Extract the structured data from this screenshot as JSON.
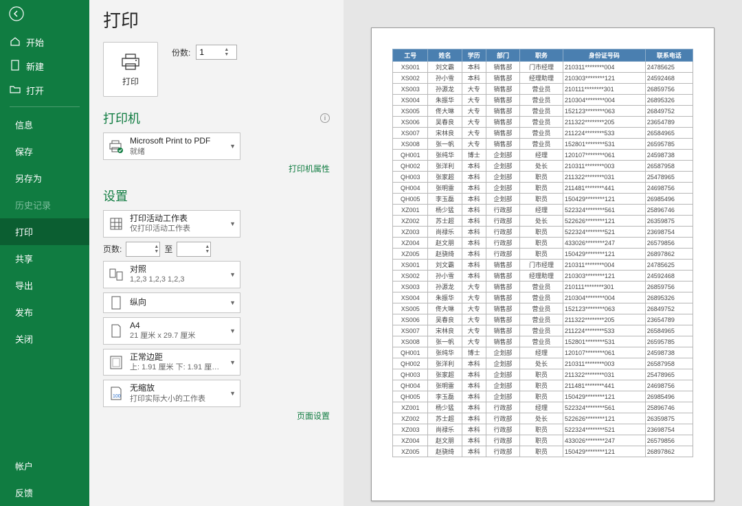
{
  "sidebar": {
    "items": [
      {
        "icon": "home",
        "label": "开始"
      },
      {
        "icon": "new",
        "label": "新建"
      },
      {
        "icon": "open",
        "label": "打开"
      }
    ],
    "items2": [
      {
        "label": "信息"
      },
      {
        "label": "保存"
      },
      {
        "label": "另存为"
      },
      {
        "label": "历史记录",
        "disabled": true
      },
      {
        "label": "打印",
        "selected": true
      },
      {
        "label": "共享"
      },
      {
        "label": "导出"
      },
      {
        "label": "发布"
      },
      {
        "label": "关闭"
      }
    ],
    "footer": [
      {
        "label": "帐户"
      },
      {
        "label": "反馈"
      }
    ]
  },
  "panel": {
    "title": "打印",
    "print_label": "打印",
    "copies_label": "份数:",
    "copies_value": "1",
    "printer_heading": "打印机",
    "printer_name": "Microsoft Print to PDF",
    "printer_status": "就绪",
    "printer_props": "打印机属性",
    "settings_heading": "设置",
    "what_main": "打印活动工作表",
    "what_sub": "仅打印活动工作表",
    "pages_label": "页数:",
    "pages_to": "至",
    "collate_main": "对照",
    "collate_sub": "1,2,3    1,2,3    1,2,3",
    "orient": "纵向",
    "paper_main": "A4",
    "paper_sub": "21 厘米 x 29.7 厘米",
    "margin_main": "正常边距",
    "margin_sub": "上: 1.91 厘米 下: 1.91 厘…",
    "scale_main": "无缩放",
    "scale_sub": "打印实际大小的工作表",
    "page_setup": "页面设置"
  },
  "preview": {
    "headers": [
      "工号",
      "姓名",
      "学历",
      "部门",
      "职务",
      "身份证号码",
      "联系电话"
    ],
    "rows": [
      [
        "XS001",
        "刘文霸",
        "本科",
        "销售部",
        "门市经理",
        "210311********004",
        "24785625"
      ],
      [
        "XS002",
        "孙小雪",
        "本科",
        "销售部",
        "经理助理",
        "210303********121",
        "24592468"
      ],
      [
        "XS003",
        "孙源龙",
        "大专",
        "销售部",
        "营业员",
        "210111********301",
        "26859756"
      ],
      [
        "XS004",
        "朱振华",
        "大专",
        "销售部",
        "营业员",
        "210304********004",
        "26895326"
      ],
      [
        "XS005",
        "佟大琳",
        "大专",
        "销售部",
        "营业员",
        "152123********063",
        "26849752"
      ],
      [
        "XS006",
        "吴春良",
        "大专",
        "销售部",
        "营业员",
        "211322********205",
        "23654789"
      ],
      [
        "XS007",
        "宋林良",
        "大专",
        "销售部",
        "营业员",
        "211224********533",
        "26584965"
      ],
      [
        "XS008",
        "张一帆",
        "大专",
        "销售部",
        "营业员",
        "152801********531",
        "26595785"
      ],
      [
        "QH001",
        "张纯华",
        "博士",
        "企划部",
        "经理",
        "120107********061",
        "24598738"
      ],
      [
        "QH002",
        "张洋利",
        "本科",
        "企划部",
        "处长",
        "210311********003",
        "26587958"
      ],
      [
        "QH003",
        "张家超",
        "本科",
        "企划部",
        "职员",
        "211322********031",
        "25478965"
      ],
      [
        "QH004",
        "张明雷",
        "本科",
        "企划部",
        "职员",
        "211481********441",
        "24698756"
      ],
      [
        "QH005",
        "李玉磊",
        "本科",
        "企划部",
        "职员",
        "150429********121",
        "26985496"
      ],
      [
        "XZ001",
        "杨少猛",
        "本科",
        "行政部",
        "经理",
        "522324********561",
        "25896746"
      ],
      [
        "XZ002",
        "苏士超",
        "本科",
        "行政部",
        "处长",
        "522626********121",
        "26359875"
      ],
      [
        "XZ003",
        "尚禄乐",
        "本科",
        "行政部",
        "职员",
        "522324********521",
        "23698754"
      ],
      [
        "XZ004",
        "赵文朋",
        "本科",
        "行政部",
        "职员",
        "433026********247",
        "26579856"
      ],
      [
        "XZ005",
        "赵骁绮",
        "本科",
        "行政部",
        "职员",
        "150429********121",
        "26897862"
      ],
      [
        "XS001",
        "刘文霸",
        "本科",
        "销售部",
        "门市经理",
        "210311********004",
        "24785625"
      ],
      [
        "XS002",
        "孙小雪",
        "本科",
        "销售部",
        "经理助理",
        "210303********121",
        "24592468"
      ],
      [
        "XS003",
        "孙源龙",
        "大专",
        "销售部",
        "营业员",
        "210111********301",
        "26859756"
      ],
      [
        "XS004",
        "朱振华",
        "大专",
        "销售部",
        "营业员",
        "210304********004",
        "26895326"
      ],
      [
        "XS005",
        "佟大琳",
        "大专",
        "销售部",
        "营业员",
        "152123********063",
        "26849752"
      ],
      [
        "XS006",
        "吴春良",
        "大专",
        "销售部",
        "营业员",
        "211322********205",
        "23654789"
      ],
      [
        "XS007",
        "宋林良",
        "大专",
        "销售部",
        "营业员",
        "211224********533",
        "26584965"
      ],
      [
        "XS008",
        "张一帆",
        "大专",
        "销售部",
        "营业员",
        "152801********531",
        "26595785"
      ],
      [
        "QH001",
        "张纯华",
        "博士",
        "企划部",
        "经理",
        "120107********061",
        "24598738"
      ],
      [
        "QH002",
        "张洋利",
        "本科",
        "企划部",
        "处长",
        "210311********003",
        "26587958"
      ],
      [
        "QH003",
        "张家超",
        "本科",
        "企划部",
        "职员",
        "211322********031",
        "25478965"
      ],
      [
        "QH004",
        "张明雷",
        "本科",
        "企划部",
        "职员",
        "211481********441",
        "24698756"
      ],
      [
        "QH005",
        "李玉磊",
        "本科",
        "企划部",
        "职员",
        "150429********121",
        "26985496"
      ],
      [
        "XZ001",
        "杨少猛",
        "本科",
        "行政部",
        "经理",
        "522324********561",
        "25896746"
      ],
      [
        "XZ002",
        "苏士超",
        "本科",
        "行政部",
        "处长",
        "522626********121",
        "26359875"
      ],
      [
        "XZ003",
        "尚禄乐",
        "本科",
        "行政部",
        "职员",
        "522324********521",
        "23698754"
      ],
      [
        "XZ004",
        "赵文朋",
        "本科",
        "行政部",
        "职员",
        "433026********247",
        "26579856"
      ],
      [
        "XZ005",
        "赵骁绮",
        "本科",
        "行政部",
        "职员",
        "150429********121",
        "26897862"
      ]
    ]
  }
}
